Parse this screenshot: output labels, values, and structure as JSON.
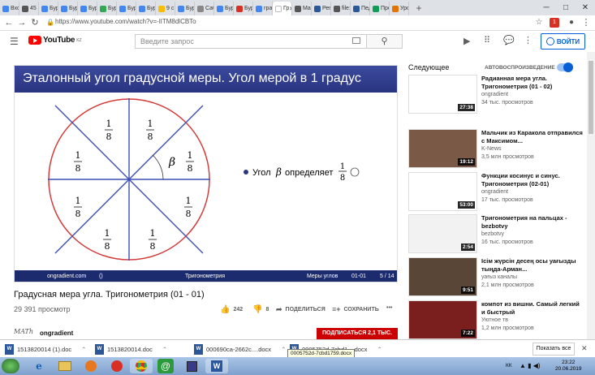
{
  "browser": {
    "tabs": [
      {
        "label": "Вхо",
        "color": "#4285f4"
      },
      {
        "label": "45 ",
        "color": "#555555"
      },
      {
        "label": "Бур",
        "color": "#4285f4"
      },
      {
        "label": "Бур",
        "color": "#4285f4"
      },
      {
        "label": "Бур",
        "color": "#4285f4"
      },
      {
        "label": "Бур",
        "color": "#34a853"
      },
      {
        "label": "Бур",
        "color": "#4285f4"
      },
      {
        "label": "Бур",
        "color": "#4285f4"
      },
      {
        "label": "9 с",
        "color": "#fbbc05"
      },
      {
        "label": "Бур",
        "color": "#4285f4"
      },
      {
        "label": "Саб",
        "color": "#888888"
      },
      {
        "label": "Бур",
        "color": "#4285f4"
      },
      {
        "label": "Бур",
        "color": "#d93025"
      },
      {
        "label": "гра",
        "color": "#4285f4"
      },
      {
        "label": "Гр",
        "color": "#ffffff",
        "active": true
      },
      {
        "label": "Ма",
        "color": "#555555"
      },
      {
        "label": "Реп",
        "color": "#2b579a"
      },
      {
        "label": "file:",
        "color": "#555555"
      },
      {
        "label": "Пед",
        "color": "#2b579a"
      },
      {
        "label": "Про",
        "color": "#0f9d58"
      },
      {
        "label": "Уро",
        "color": "#e37400"
      }
    ],
    "url": "https://www.youtube.com/watch?v=-lITM8dlCBTo",
    "badge_count": "1"
  },
  "youtube": {
    "logo_text": "YouTube",
    "logo_region": "KZ",
    "search_placeholder": "Введите запрос",
    "login_label": "ВОЙТИ",
    "video_title": "Градусная мера угла. Тригонометрия (01 - 01)",
    "views": "29 391 просмотр",
    "likes": "242",
    "dislikes": "8",
    "share_label": "ПОДЕЛИТЬСЯ",
    "save_label": "СОХРАНИТЬ",
    "more_label": "•••",
    "channel_name": "ongradient",
    "channel_logo": "MATh",
    "subscribe_label": "ПОДПИСАТЬСЯ  2,1 ТЫС."
  },
  "slide": {
    "heading": "Эталонный угол градусной меры. Угол мерой в 1 градус",
    "bullet_text": "Угол",
    "beta": "β",
    "defines_text": "определяет",
    "fraction_num": "1",
    "fraction_den": "8",
    "angle_label": "β",
    "footer_site": "ongradient.com",
    "footer_paren": "()",
    "footer_subject": "Тригонометрия",
    "footer_topic": "Меры углов",
    "footer_code": "01-01",
    "footer_page": "5 / 14"
  },
  "sidebar": {
    "upnext_label": "Следующее",
    "autoplay_label": "АВТОВОСПРОИЗВЕДЕНИЕ",
    "autoplay_on": true,
    "items": [
      {
        "title": "Радианная мера угла. Тригонометрия (01 - 02)",
        "channel": "ongradient",
        "views": "34 тыс. просмотров",
        "duration": "27:38",
        "thumb_color": "#ffffff"
      },
      {
        "title": "Мальчик из Каракола отправился с Максимом...",
        "channel": "K-News",
        "views": "3,5 млн просмотров",
        "duration": "19:12",
        "thumb_color": "#7a5a46"
      },
      {
        "title": "Функции косинус и синус. Тригонометрия (02-01)",
        "channel": "ongradient",
        "views": "17 тыс. просмотров",
        "duration": "53:00",
        "thumb_color": "#ffffff"
      },
      {
        "title": "Тригонометрия на пальцах - bezbotvy",
        "channel": "bezbotvy",
        "views": "16 тыс. просмотров",
        "duration": "2:54",
        "thumb_color": "#f2f2f2"
      },
      {
        "title": "Ісім жүрсін десең осы уағызды тыңда-Арман...",
        "channel": "уағыз каналы",
        "views": "2,1 млн просмотров",
        "duration": "9:51",
        "thumb_color": "#5a4636"
      },
      {
        "title": "компот из вишни. Самый легкий и быстрый",
        "channel": "Уютное тв",
        "views": "1,2 млн просмотров",
        "duration": "7:22",
        "thumb_color": "#7a1e1e"
      }
    ]
  },
  "downloads": {
    "items": [
      {
        "name": "1513820014 (1).doc"
      },
      {
        "name": "1513820014.doc"
      },
      {
        "name": "000690ca-2662c....docx"
      },
      {
        "name": "0005752d-7cbd1....docx"
      }
    ],
    "tooltip": "0005752d-7cbd1759.docx",
    "show_all_label": "Показать все"
  },
  "taskbar": {
    "lang": "КК",
    "time": "23:22",
    "date": "20.06.2019"
  }
}
